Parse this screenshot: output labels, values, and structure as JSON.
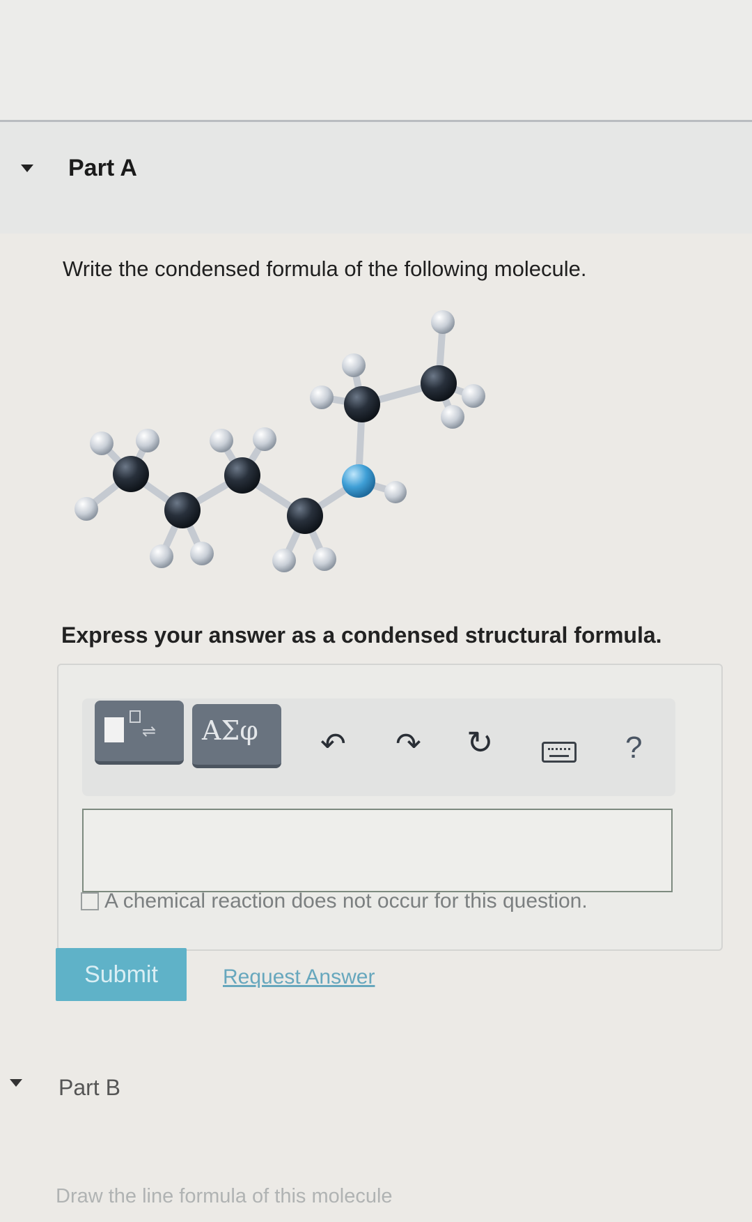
{
  "part_a": {
    "title": "Part A",
    "question": "Write the condensed formula of the following molecule.",
    "instructions": "Express your answer as a condensed structural formula."
  },
  "toolbar": {
    "templates_icon": "templates-icon",
    "symbols_label": "ΑΣφ",
    "undo_icon": "undo-icon",
    "redo_icon": "redo-icon",
    "reset_icon": "reset-icon",
    "keyboard_icon": "keyboard-icon",
    "help_label": "?"
  },
  "answer": {
    "value": "",
    "no_reaction_label": "A chemical reaction does not occur for this question."
  },
  "actions": {
    "submit_label": "Submit",
    "request_answer_label": "Request Answer"
  },
  "part_b": {
    "title": "Part B",
    "question": "Draw the line formula of this molecule"
  },
  "colors": {
    "submit": "#5fb2c8",
    "toolbar_button": "#69737f",
    "carbon": "#1f2630",
    "hydrogen": "#c8ced6",
    "oxygen": "#3f9fd6"
  }
}
